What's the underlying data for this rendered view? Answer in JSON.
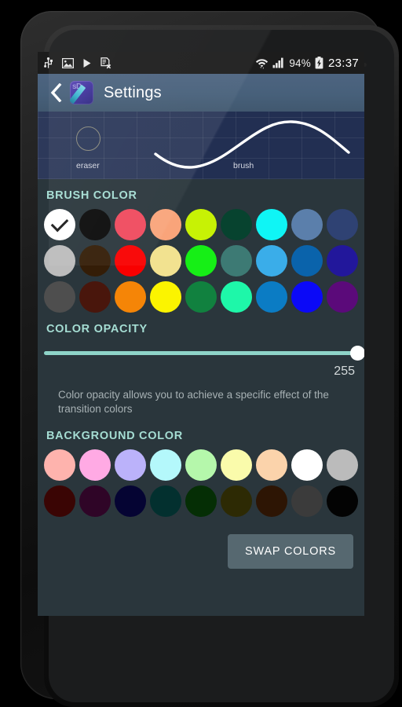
{
  "status_bar": {
    "left_icons": [
      "usb-icon",
      "image-icon",
      "play-icon",
      "document-remove-icon"
    ],
    "right_icons": [
      "wifi-icon",
      "signal-icon",
      "battery-charging-icon"
    ],
    "battery_percent": "94%",
    "clock": "23:37"
  },
  "action_bar": {
    "back_icon": "back-chevron-icon",
    "app_icon": "sdraw-app-icon",
    "app_icon_letters": "sD",
    "title": "Settings"
  },
  "preview": {
    "eraser_label": "eraser",
    "brush_label": "brush",
    "background": "#222f52",
    "stroke_color": "#ffffff",
    "eraser_outline": "#8b8b7e"
  },
  "brush_color": {
    "header": "BRUSH COLOR",
    "selected_index": 0,
    "rows": [
      [
        "#ffffff",
        "#0a0a0a",
        "#ef4a5e",
        "#f9a47a",
        "#c7f205",
        "#07432f",
        "#0ff5f5",
        "#5b7fab",
        "#2f4273"
      ],
      [
        "#bcbcbc",
        "#341d07",
        "#f90000",
        "#f2e290",
        "#16ef16",
        "#3d7a74",
        "#3aade9",
        "#0a63ab",
        "#22179b"
      ],
      [
        "#4e4e4e",
        "#49160c",
        "#f58507",
        "#fbf400",
        "#11813f",
        "#1ef7a9",
        "#0b7cc4",
        "#0b09f7",
        "#5b0a7a"
      ]
    ]
  },
  "color_opacity": {
    "header": "COLOR OPACITY",
    "value": "255",
    "max": 255,
    "percent": 100,
    "description": "Color opacity allows you to achieve a specific effect of the transition colors",
    "track_color": "#8ed4c8",
    "thumb_color": "#ffffff"
  },
  "background_color": {
    "header": "BACKGROUND COLOR",
    "rows": [
      [
        "#feb3ad",
        "#ffaae4",
        "#bbb2fa",
        "#b4f8fb",
        "#b5f7ab",
        "#fafbab",
        "#fbd3ab",
        "#ffffff",
        "#bbbbbb"
      ],
      [
        "#3a0504",
        "#2f0527",
        "#050433",
        "#03302f",
        "#052e05",
        "#2d2a04",
        "#2d1504",
        "#3b3b3b",
        "#030303"
      ]
    ]
  },
  "swap_button": {
    "label": "SWAP COLORS",
    "background": "#566870"
  },
  "theme": {
    "screen_background": "#2a363c",
    "action_bar": "#47607a",
    "accent": "#a5ddd3"
  }
}
